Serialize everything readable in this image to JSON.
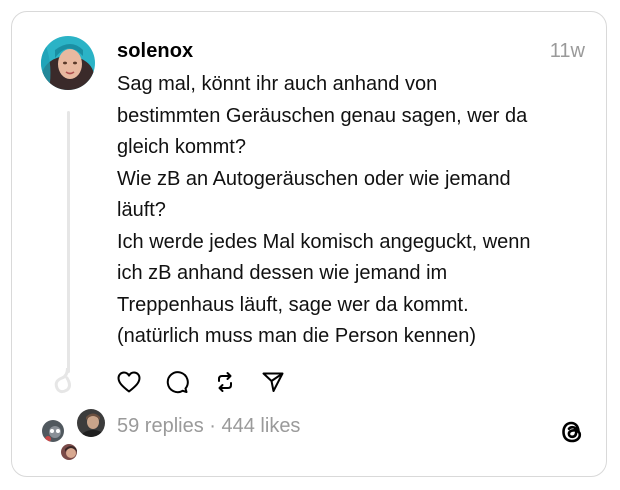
{
  "post": {
    "username": "solenox",
    "timestamp": "11w",
    "lines": [
      "Sag mal, könnt ihr auch anhand von",
      "bestimmten Geräuschen genau sagen, wer da",
      "gleich kommt?",
      "Wie zB an Autogeräuschen oder wie jemand",
      "läuft?",
      "Ich werde jedes Mal komisch angeguckt, wenn",
      "ich zB anhand dessen wie jemand im",
      "Treppenhaus läuft, sage wer da kommt.",
      "(natürlich muss man die Person kennen)"
    ]
  },
  "actions": {
    "icons": [
      "heart-icon",
      "comment-icon",
      "repost-icon",
      "share-icon"
    ]
  },
  "stats": {
    "replies": "59 replies",
    "separator": "·",
    "likes": "444 likes"
  },
  "colors": {
    "border": "#d9d9d9",
    "muted_text": "#9a9a9a",
    "thread_line": "#e6e6e6",
    "avatar_teal": "#1fb5c9"
  }
}
